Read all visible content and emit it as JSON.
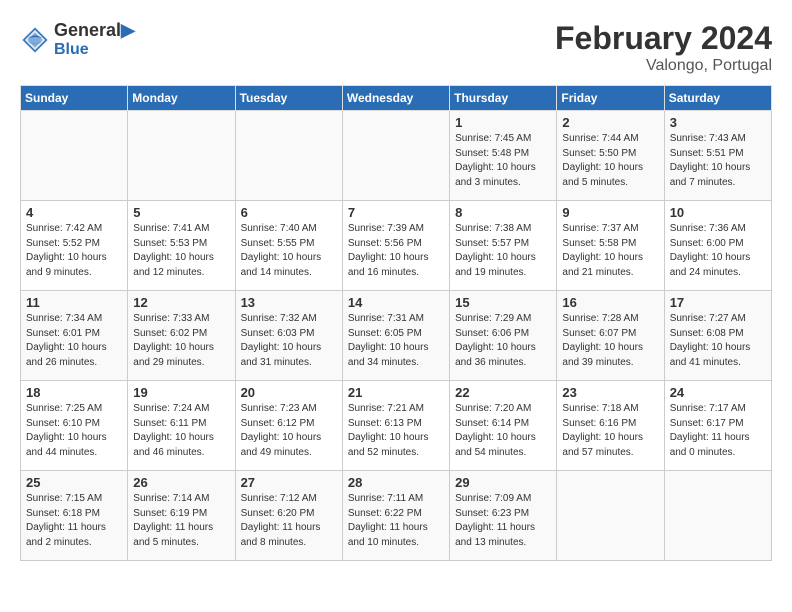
{
  "header": {
    "logo_line1": "General",
    "logo_line2": "Blue",
    "title": "February 2024",
    "subtitle": "Valongo, Portugal"
  },
  "columns": [
    "Sunday",
    "Monday",
    "Tuesday",
    "Wednesday",
    "Thursday",
    "Friday",
    "Saturday"
  ],
  "weeks": [
    [
      {
        "day": "",
        "info": ""
      },
      {
        "day": "",
        "info": ""
      },
      {
        "day": "",
        "info": ""
      },
      {
        "day": "",
        "info": ""
      },
      {
        "day": "1",
        "info": "Sunrise: 7:45 AM\nSunset: 5:48 PM\nDaylight: 10 hours\nand 3 minutes."
      },
      {
        "day": "2",
        "info": "Sunrise: 7:44 AM\nSunset: 5:50 PM\nDaylight: 10 hours\nand 5 minutes."
      },
      {
        "day": "3",
        "info": "Sunrise: 7:43 AM\nSunset: 5:51 PM\nDaylight: 10 hours\nand 7 minutes."
      }
    ],
    [
      {
        "day": "4",
        "info": "Sunrise: 7:42 AM\nSunset: 5:52 PM\nDaylight: 10 hours\nand 9 minutes."
      },
      {
        "day": "5",
        "info": "Sunrise: 7:41 AM\nSunset: 5:53 PM\nDaylight: 10 hours\nand 12 minutes."
      },
      {
        "day": "6",
        "info": "Sunrise: 7:40 AM\nSunset: 5:55 PM\nDaylight: 10 hours\nand 14 minutes."
      },
      {
        "day": "7",
        "info": "Sunrise: 7:39 AM\nSunset: 5:56 PM\nDaylight: 10 hours\nand 16 minutes."
      },
      {
        "day": "8",
        "info": "Sunrise: 7:38 AM\nSunset: 5:57 PM\nDaylight: 10 hours\nand 19 minutes."
      },
      {
        "day": "9",
        "info": "Sunrise: 7:37 AM\nSunset: 5:58 PM\nDaylight: 10 hours\nand 21 minutes."
      },
      {
        "day": "10",
        "info": "Sunrise: 7:36 AM\nSunset: 6:00 PM\nDaylight: 10 hours\nand 24 minutes."
      }
    ],
    [
      {
        "day": "11",
        "info": "Sunrise: 7:34 AM\nSunset: 6:01 PM\nDaylight: 10 hours\nand 26 minutes."
      },
      {
        "day": "12",
        "info": "Sunrise: 7:33 AM\nSunset: 6:02 PM\nDaylight: 10 hours\nand 29 minutes."
      },
      {
        "day": "13",
        "info": "Sunrise: 7:32 AM\nSunset: 6:03 PM\nDaylight: 10 hours\nand 31 minutes."
      },
      {
        "day": "14",
        "info": "Sunrise: 7:31 AM\nSunset: 6:05 PM\nDaylight: 10 hours\nand 34 minutes."
      },
      {
        "day": "15",
        "info": "Sunrise: 7:29 AM\nSunset: 6:06 PM\nDaylight: 10 hours\nand 36 minutes."
      },
      {
        "day": "16",
        "info": "Sunrise: 7:28 AM\nSunset: 6:07 PM\nDaylight: 10 hours\nand 39 minutes."
      },
      {
        "day": "17",
        "info": "Sunrise: 7:27 AM\nSunset: 6:08 PM\nDaylight: 10 hours\nand 41 minutes."
      }
    ],
    [
      {
        "day": "18",
        "info": "Sunrise: 7:25 AM\nSunset: 6:10 PM\nDaylight: 10 hours\nand 44 minutes."
      },
      {
        "day": "19",
        "info": "Sunrise: 7:24 AM\nSunset: 6:11 PM\nDaylight: 10 hours\nand 46 minutes."
      },
      {
        "day": "20",
        "info": "Sunrise: 7:23 AM\nSunset: 6:12 PM\nDaylight: 10 hours\nand 49 minutes."
      },
      {
        "day": "21",
        "info": "Sunrise: 7:21 AM\nSunset: 6:13 PM\nDaylight: 10 hours\nand 52 minutes."
      },
      {
        "day": "22",
        "info": "Sunrise: 7:20 AM\nSunset: 6:14 PM\nDaylight: 10 hours\nand 54 minutes."
      },
      {
        "day": "23",
        "info": "Sunrise: 7:18 AM\nSunset: 6:16 PM\nDaylight: 10 hours\nand 57 minutes."
      },
      {
        "day": "24",
        "info": "Sunrise: 7:17 AM\nSunset: 6:17 PM\nDaylight: 11 hours\nand 0 minutes."
      }
    ],
    [
      {
        "day": "25",
        "info": "Sunrise: 7:15 AM\nSunset: 6:18 PM\nDaylight: 11 hours\nand 2 minutes."
      },
      {
        "day": "26",
        "info": "Sunrise: 7:14 AM\nSunset: 6:19 PM\nDaylight: 11 hours\nand 5 minutes."
      },
      {
        "day": "27",
        "info": "Sunrise: 7:12 AM\nSunset: 6:20 PM\nDaylight: 11 hours\nand 8 minutes."
      },
      {
        "day": "28",
        "info": "Sunrise: 7:11 AM\nSunset: 6:22 PM\nDaylight: 11 hours\nand 10 minutes."
      },
      {
        "day": "29",
        "info": "Sunrise: 7:09 AM\nSunset: 6:23 PM\nDaylight: 11 hours\nand 13 minutes."
      },
      {
        "day": "",
        "info": ""
      },
      {
        "day": "",
        "info": ""
      }
    ]
  ]
}
